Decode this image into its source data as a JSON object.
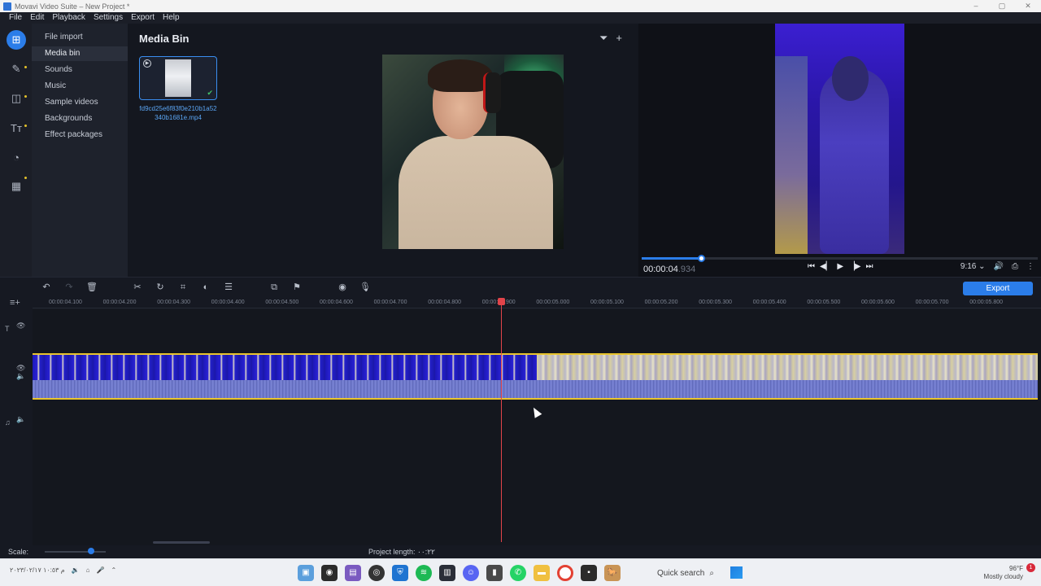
{
  "window": {
    "title": "Movavi Video Suite – New Project *",
    "controls": [
      "–",
      "▢",
      "✕"
    ]
  },
  "menu": [
    "File",
    "Edit",
    "Playback",
    "Settings",
    "Export",
    "Help"
  ],
  "categories": [
    "File import",
    "Media bin",
    "Sounds",
    "Music",
    "Sample videos",
    "Backgrounds",
    "Effect packages"
  ],
  "active_category": "Media bin",
  "media_bin": {
    "title": "Media Bin",
    "file_name": "fd9cd25e6f83f0e210b1a52340b1681e.mp4"
  },
  "preview": {
    "time": "00:00:04",
    "time_ms": ".934",
    "aspect": "9:16",
    "progress": 0.15
  },
  "toolbar": {
    "export_label": "Export"
  },
  "ruler_ticks": [
    "00:00:04.100",
    "00:00:04.200",
    "00:00:04.300",
    "00:00:04.400",
    "00:00:04.500",
    "00:00:04.600",
    "00:00:04.700",
    "00:00:04.800",
    "00:00:04.900",
    "00:00:05.000",
    "00:00:05.100",
    "00:00:05.200",
    "00:00:05.300",
    "00:00:05.400",
    "00:00:05.500",
    "00:00:05.600",
    "00:00:05.700",
    "00:00:05.800"
  ],
  "status": {
    "scale_label": "Scale:",
    "project_length": "Project length:  ٠٠:٢٢"
  },
  "taskbar": {
    "clock": "م ١٠:٥٣ ٢٠٢٣/٠٢/١٧",
    "search_label": "Quick search",
    "temperature": "96°F",
    "weather": "Mostly cloudy",
    "notifications": "1"
  },
  "colors": {
    "accent": "#2b7de9",
    "playhead": "#e2444a",
    "clip_border": "#e8c42d"
  }
}
